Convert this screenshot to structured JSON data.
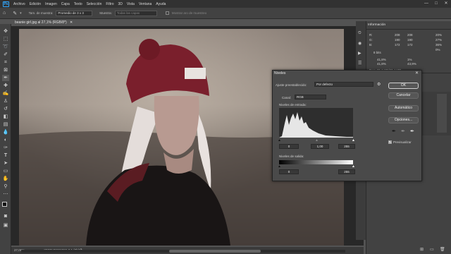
{
  "menubar": {
    "logo": "Ps",
    "items": [
      "Archivo",
      "Edición",
      "Imagen",
      "Capa",
      "Texto",
      "Selección",
      "Filtro",
      "3D",
      "Vista",
      "Ventana",
      "Ayuda"
    ],
    "window_controls": [
      "—",
      "□",
      "✕"
    ]
  },
  "options_bar": {
    "sample_size_label": "Tam. de muestra:",
    "sample_size_value": "Promedio de 3 x 3",
    "sample_label": "Muestra:",
    "sample_value": "Todas las capas",
    "show_ring_label": "Mostrar aro de muestreo"
  },
  "document": {
    "tab_title": "beanie girl.jpg al 27,1% (RGB/8*)",
    "tab_close": "✕"
  },
  "status": {
    "zoom": "27,06%",
    "profile": "sRGB IEC61966-2.1 (8bits)",
    "arrow": "›"
  },
  "info_panel": {
    "tab": "Información",
    "rgb1": {
      "r": "208",
      "g": "190",
      "b": "172"
    },
    "rgb2": {
      "r": "208",
      "g": "190",
      "b": "172"
    },
    "cmyk": {
      "c": "20%",
      "m": "27%",
      "y": "36%",
      "k": "0%"
    },
    "bits": "8 bits",
    "xy": {
      "x": "41,8%",
      "y": "41,8%"
    },
    "wh": {
      "w": "1%",
      "h": "43,9%"
    },
    "xy2": {
      "x": "43,9%",
      "y": "43,9%"
    },
    "doc": "Doc: 33,4 MB/33,4 MB"
  },
  "levels_dialog": {
    "title": "Niveles",
    "close": "✕",
    "preset_label": "Ajuste preestablecido:",
    "preset_value": "Por defecto",
    "channel_label": "Canal:",
    "channel_value": "RGB",
    "input_levels_label": "Niveles de entrada:",
    "input_black": "0",
    "input_gamma": "1,00",
    "input_white": "255",
    "output_levels_label": "Niveles de salida:",
    "output_black": "0",
    "output_white": "255",
    "ok_label": "OK",
    "cancel_label": "Cancelar",
    "auto_label": "Automático",
    "options_label": "Opciones...",
    "preview_label": "Previsualizar",
    "preview_checked": true
  },
  "colors": {
    "accent": "#31a8ff",
    "menubar_bg": "#323232",
    "panel_bg": "#424242",
    "dialog_bg": "#4a4a4a"
  },
  "icons": [
    "move-icon",
    "marquee-icon",
    "lasso-icon",
    "quick-select-icon",
    "crop-icon",
    "frame-icon",
    "eyedropper-icon",
    "healing-icon",
    "brush-icon",
    "stamp-icon",
    "history-brush-icon",
    "eraser-icon",
    "gradient-icon",
    "blur-icon",
    "dodge-icon",
    "pen-icon",
    "type-icon",
    "path-select-icon",
    "rectangle-icon",
    "hand-icon",
    "zoom-icon",
    "edit-toolbar-icon",
    "foreground-background-icon",
    "quick-mask-icon",
    "screen-mode-icon"
  ]
}
